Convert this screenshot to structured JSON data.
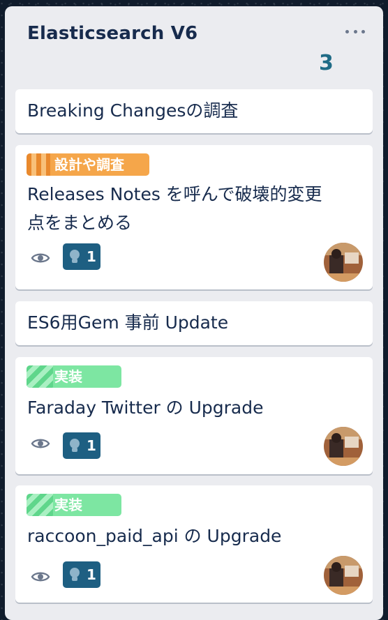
{
  "list": {
    "title": "Elasticsearch V6",
    "card_count": "3"
  },
  "cards": [
    {
      "title": "Breaking Changesの調査"
    },
    {
      "label": "設計や調査",
      "label_color": "#f5a64a",
      "title_line1": "Releases Notes を呼んで破壊的変更",
      "title_line2": "点をまとめる",
      "badge_count": "1"
    },
    {
      "title": "ES6用Gem 事前 Update"
    },
    {
      "label": "実装",
      "label_color": "#7de6a2",
      "title": "Faraday Twitter の Upgrade",
      "badge_count": "1"
    },
    {
      "label": "実装",
      "label_color": "#7de6a2",
      "title": "raccoon_paid_api の Upgrade",
      "badge_count": "1"
    }
  ],
  "icons": {
    "menu": "more-horizontal-icon",
    "watch": "eye-icon",
    "badge": "lightbulb-icon"
  },
  "colors": {
    "list_bg": "#ebecf0",
    "card_bg": "#ffffff",
    "text": "#172b4d",
    "count": "#1f6b86",
    "badge": "#1e5f82"
  }
}
